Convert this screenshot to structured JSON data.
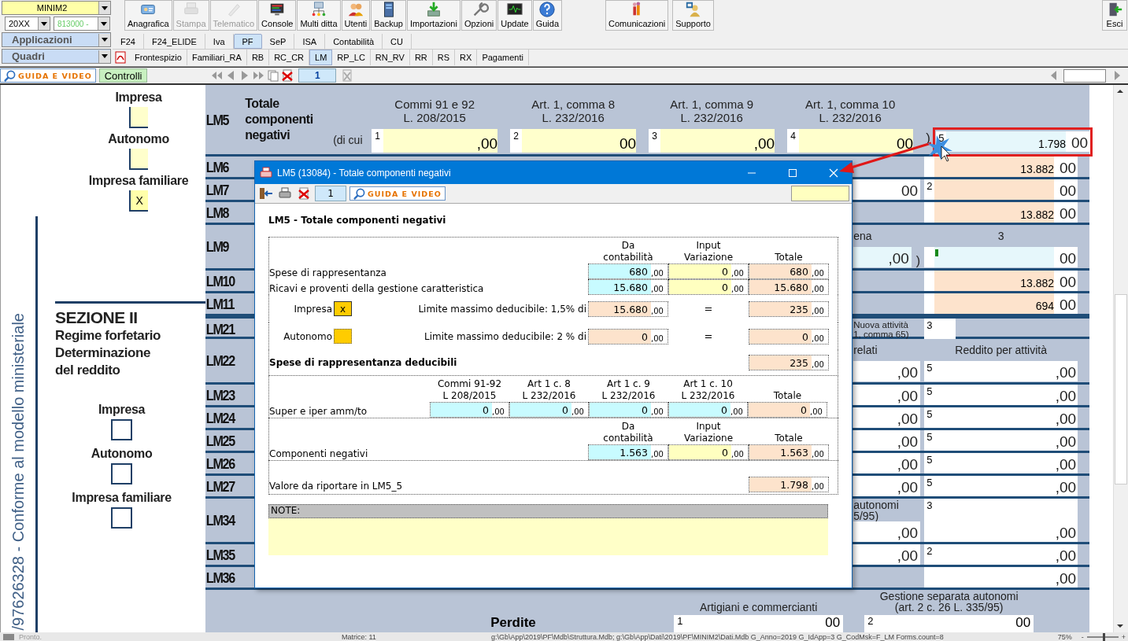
{
  "toolbar": {
    "company_combo": "MINIM2",
    "year_combo": "20XX",
    "code_combo": "813000 -",
    "applications_combo": "Applicazioni",
    "quadri_combo": "Quadri",
    "buttons": [
      {
        "label": "Anagrafica",
        "disabled": false
      },
      {
        "label": "Stampa",
        "disabled": true
      },
      {
        "label": "Telematico",
        "disabled": true
      },
      {
        "label": "Console",
        "disabled": false
      },
      {
        "label": "Multi ditta",
        "disabled": false
      },
      {
        "label": "Utenti",
        "disabled": false
      },
      {
        "label": "Backup",
        "disabled": false
      },
      {
        "label": "Importazioni",
        "disabled": false
      },
      {
        "label": "Opzioni",
        "disabled": false
      },
      {
        "label": "Update",
        "disabled": false
      },
      {
        "label": "Guida",
        "disabled": false
      }
    ],
    "extra_buttons": [
      {
        "label": "Comunicazioni",
        "disabled": false
      },
      {
        "label": "Supporto",
        "disabled": false
      }
    ],
    "exit_button": "Esci"
  },
  "app_tabs": [
    {
      "label": "F24",
      "selected": false
    },
    {
      "label": "F24_ELIDE",
      "selected": false
    },
    {
      "label": "Iva",
      "selected": false
    },
    {
      "label": "PF",
      "selected": true
    },
    {
      "label": "SeP",
      "selected": false
    },
    {
      "label": "ISA",
      "selected": false
    },
    {
      "label": "Contabilità",
      "selected": false
    },
    {
      "label": "CU",
      "selected": false
    }
  ],
  "quadri_tabs": [
    {
      "label": "Frontespizio",
      "selected": false
    },
    {
      "label": "Familiari_RA",
      "selected": false
    },
    {
      "label": "RB",
      "selected": false
    },
    {
      "label": "RC_CR",
      "selected": false
    },
    {
      "label": "LM",
      "selected": true
    },
    {
      "label": "RP_LC",
      "selected": false
    },
    {
      "label": "RN_RV",
      "selected": false
    },
    {
      "label": "RR",
      "selected": false
    },
    {
      "label": "RS",
      "selected": false
    },
    {
      "label": "RX",
      "selected": false
    },
    {
      "label": "Pagamenti",
      "selected": false
    }
  ],
  "nav_bar": {
    "guide_button": "GUIDA E VIDEO",
    "controls_button": "Controlli",
    "page": "1"
  },
  "left_panel": {
    "top_checkboxes": [
      {
        "label": "Impresa",
        "checked": false
      },
      {
        "label": "Autonomo",
        "checked": false
      },
      {
        "label": "Impresa familiare",
        "checked": true,
        "mark": "X"
      }
    ],
    "vertical_caption": "/97626328 - Conforme al modello ministeriale",
    "section_title": "SEZIONE II",
    "section_subtitle": [
      "Regime forfetario",
      "Determinazione",
      "del reddito"
    ],
    "bottom_checkboxes": [
      {
        "label": "Impresa",
        "checked": false
      },
      {
        "label": "Autonomo",
        "checked": false
      },
      {
        "label": "Impresa familiare",
        "checked": false
      }
    ]
  },
  "form": {
    "lm5": {
      "code": "LM5",
      "title": [
        "Totale",
        "componenti",
        "negativi"
      ],
      "di_cui": "(di cui",
      "close_paren": ")",
      "columns": [
        {
          "header": [
            "Commi 91 e 92",
            "L. 208/2015"
          ],
          "number": "1",
          "cents": ",00"
        },
        {
          "header": [
            "Art. 1, comma 8",
            "L. 232/2016"
          ],
          "number": "2",
          "cents": "00"
        },
        {
          "header": [
            "Art. 1, comma 9",
            "L. 232/2016"
          ],
          "number": "3",
          "cents": ",00"
        },
        {
          "header": [
            "Art. 1, comma 10",
            "L. 232/2016"
          ],
          "number": "4",
          "cents": "00"
        }
      ],
      "total": {
        "number": "5",
        "value": "1.798",
        "cents": "00",
        "kind": "input",
        "highlighted": true
      }
    },
    "rows": [
      {
        "code": "LM6",
        "col_b": {
          "kind": "total",
          "value": "13.882",
          "cents": "00"
        }
      },
      {
        "code": "LM7",
        "col_a": {
          "kind": "plain",
          "cents": "00"
        },
        "col_b": {
          "kind": "total",
          "number": "2",
          "cents": "00"
        }
      },
      {
        "code": "LM8",
        "col_b": {
          "kind": "total",
          "value": "13.882",
          "cents": "00"
        }
      },
      {
        "code": "LM9",
        "header_a": [
          "ena"
        ],
        "header_b": [
          "3"
        ],
        "col_a": {
          "kind": "input",
          "cents": ",00",
          "paren": ")"
        },
        "col_b": {
          "kind": "input",
          "marker": true,
          "cents": "00"
        }
      },
      {
        "code": "LM10",
        "col_b": {
          "kind": "total",
          "value": "13.882",
          "cents": "00"
        }
      },
      {
        "code": "LM11",
        "col_b": {
          "kind": "total",
          "value": "694",
          "cents": "00"
        }
      },
      {
        "code": "LM21",
        "section_start": true,
        "text_a": [
          "Nuova attività",
          "1, comma 65)"
        ],
        "col_b": {
          "kind": "short",
          "number": "3"
        }
      },
      {
        "code": "LM22",
        "header_a": [
          "relati"
        ],
        "header_b": [
          "Reddito per attività"
        ],
        "col_a": {
          "kind": "plain",
          "cents": ",00"
        },
        "col_b": {
          "kind": "plain",
          "number": "5",
          "cents": ",00"
        }
      },
      {
        "code": "LM23",
        "col_a": {
          "kind": "plain",
          "cents": ",00"
        },
        "col_b": {
          "kind": "plain",
          "number": "5",
          "cents": ",00"
        }
      },
      {
        "code": "LM24",
        "col_a": {
          "kind": "plain",
          "cents": ",00"
        },
        "col_b": {
          "kind": "plain",
          "number": "5",
          "cents": ",00"
        }
      },
      {
        "code": "LM25",
        "col_a": {
          "kind": "plain",
          "cents": ",00"
        },
        "col_b": {
          "kind": "plain",
          "number": "5",
          "cents": ",00"
        }
      },
      {
        "code": "LM26",
        "col_a": {
          "kind": "plain",
          "cents": ",00"
        },
        "col_b": {
          "kind": "plain",
          "number": "5",
          "cents": ",00"
        }
      },
      {
        "code": "LM27",
        "col_a": {
          "kind": "plain",
          "cents": ",00"
        },
        "col_b": {
          "kind": "plain",
          "number": "5",
          "cents": ",00"
        }
      },
      {
        "code": "LM34",
        "header_a": [
          "autonomi",
          "5/95)"
        ],
        "col_a": {
          "kind": "plain",
          "cents": ",00"
        },
        "col_b": {
          "kind": "tall",
          "number": "3",
          "cents": ",00"
        }
      },
      {
        "code": "LM35",
        "col_a": {
          "kind": "plain",
          "cents": ",00"
        },
        "col_b": {
          "kind": "plain",
          "number": "2",
          "cents": ",00"
        }
      },
      {
        "code": "LM36",
        "col_b": {
          "kind": "plain",
          "cents": ",00"
        }
      }
    ],
    "losses": {
      "label": "Perdite",
      "columns": [
        {
          "header": [
            "Artigiani e commercianti"
          ],
          "number": "1",
          "cents": "00"
        },
        {
          "header": [
            "Gestione separata autonomi",
            "(art. 2 c. 26 L. 335/95)"
          ],
          "number": "2",
          "cents": "00"
        }
      ]
    }
  },
  "dialog": {
    "title": "LM5 (13084) - Totale componenti negativi",
    "page": "1",
    "guide_button": "GUIDA E VIDEO",
    "heading": "LM5 - Totale componenti negativi",
    "table_1": {
      "headers": [
        [
          "Da",
          "contabilità"
        ],
        [
          "Input",
          "Variazione"
        ],
        [
          "Totale"
        ]
      ],
      "rows": [
        {
          "label": "Spese di rappresentanza",
          "cells": [
            {
              "value": "680",
              "cents": ",00",
              "kind": "accounting"
            },
            {
              "value": "0",
              "cents": ",00",
              "kind": "input"
            },
            {
              "value": "680",
              "cents": ",00",
              "kind": "total"
            }
          ]
        },
        {
          "label": "Ricavi e proventi della gestione caratteristica",
          "cells": [
            {
              "value": "15.680",
              "cents": ",00",
              "kind": "accounting"
            },
            {
              "value": "0",
              "cents": ",00",
              "kind": "input"
            },
            {
              "value": "15.680",
              "cents": ",00",
              "kind": "total"
            }
          ]
        }
      ]
    },
    "limits": [
      {
        "label": "Impresa",
        "checked": true,
        "mark": "x",
        "text": "Limite massimo deducibile: 1,5% di",
        "base": {
          "value": "15.680",
          "cents": ",00",
          "kind": "total"
        },
        "equals": "=",
        "result": {
          "value": "235",
          "cents": ",00",
          "kind": "total"
        }
      },
      {
        "label": "Autonomo",
        "checked": false,
        "text": "Limite massimo deducibile: 2 % di",
        "base": {
          "value": "0",
          "cents": ",00",
          "kind": "total"
        },
        "equals": "=",
        "result": {
          "value": "0",
          "cents": ",00",
          "kind": "total"
        }
      }
    ],
    "deductible": {
      "label": "Spese di rappresentanza deducibili",
      "cell": {
        "value": "235",
        "cents": ",00",
        "kind": "total"
      }
    },
    "table_2": {
      "headers": [
        [
          "Commi 91-92",
          "L 208/2015"
        ],
        [
          "Art 1 c. 8",
          "L 232/2016"
        ],
        [
          "Art 1 c. 9",
          "L 232/2016"
        ],
        [
          "Art 1 c. 10",
          "L 232/2016"
        ],
        [
          "Totale"
        ]
      ],
      "rows": [
        {
          "label": "Super e iper amm/to",
          "cells": [
            {
              "value": "0",
              "cents": ",00",
              "kind": "accounting"
            },
            {
              "value": "0",
              "cents": ",00",
              "kind": "accounting"
            },
            {
              "value": "0",
              "cents": ",00",
              "kind": "accounting"
            },
            {
              "value": "0",
              "cents": ",00",
              "kind": "accounting"
            },
            {
              "value": "0",
              "cents": ",00",
              "kind": "total"
            }
          ]
        }
      ]
    },
    "table_3": {
      "headers": [
        [
          "Da",
          "contabilità"
        ],
        [
          "Input",
          "Variazione"
        ],
        [
          "Totale"
        ]
      ],
      "rows": [
        {
          "label": "Componenti negativi",
          "cells": [
            {
              "value": "1.563",
              "cents": ",00",
              "kind": "accounting"
            },
            {
              "value": "0",
              "cents": ",00",
              "kind": "input"
            },
            {
              "value": "1.563",
              "cents": ",00",
              "kind": "total"
            }
          ]
        }
      ]
    },
    "result": {
      "label": "Valore da riportare in LM5_5",
      "cell": {
        "value": "1.798",
        "cents": ",00",
        "kind": "total"
      }
    },
    "note_label": "NOTE:"
  },
  "status_bar": {
    "status": "Pronto.",
    "matrix": "Matrice: 11",
    "path": "g:\\Gb\\App\\2019\\PF\\Mdb\\Struttura.Mdb; g:\\Gb\\App\\Dati\\2019\\PF\\MINIM2\\Dati.Mdb G_Anno=2019 G_IdApp=3 G_CodMsk=F_LM Forms.count=8",
    "zoom": "75%",
    "zoom_out": "-",
    "zoom_slider": {
      "level": 0.5
    },
    "zoom_in": "+"
  }
}
